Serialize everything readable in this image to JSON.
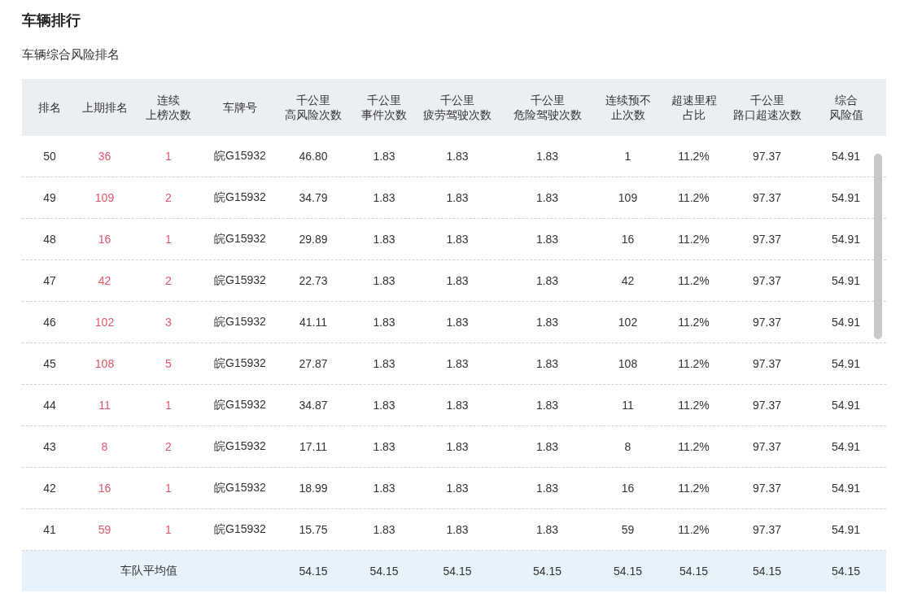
{
  "page": {
    "title": "车辆排行",
    "subtitle": "车辆综合风险排名"
  },
  "table": {
    "columns": [
      {
        "label_lines": [
          "排名"
        ],
        "kind": "plain"
      },
      {
        "label_lines": [
          "上期排名"
        ],
        "kind": "alert"
      },
      {
        "label_lines": [
          "连续",
          "上榜次数"
        ],
        "kind": "alert"
      },
      {
        "label_lines": [
          "车牌号"
        ],
        "kind": "plain"
      },
      {
        "label_lines": [
          "千公里",
          "高风险次数"
        ],
        "kind": "plain"
      },
      {
        "label_lines": [
          "千公里",
          "事件次数"
        ],
        "kind": "plain"
      },
      {
        "label_lines": [
          "千公里",
          "疲劳驾驶次数"
        ],
        "kind": "plain"
      },
      {
        "label_lines": [
          "千公里",
          "危险驾驶次数"
        ],
        "kind": "plain"
      },
      {
        "label_lines": [
          "连续预不",
          "止次数"
        ],
        "kind": "plain"
      },
      {
        "label_lines": [
          "超速里程",
          "占比"
        ],
        "kind": "plain"
      },
      {
        "label_lines": [
          "千公里",
          "路口超速次数"
        ],
        "kind": "plain"
      },
      {
        "label_lines": [
          "综合",
          "风险值"
        ],
        "kind": "plain"
      }
    ],
    "rows": [
      [
        "50",
        "36",
        "1",
        "皖G15932",
        "46.80",
        "1.83",
        "1.83",
        "1.83",
        "1",
        "11.2%",
        "97.37",
        "54.91"
      ],
      [
        "49",
        "109",
        "2",
        "皖G15932",
        "34.79",
        "1.83",
        "1.83",
        "1.83",
        "109",
        "11.2%",
        "97.37",
        "54.91"
      ],
      [
        "48",
        "16",
        "1",
        "皖G15932",
        "29.89",
        "1.83",
        "1.83",
        "1.83",
        "16",
        "11.2%",
        "97.37",
        "54.91"
      ],
      [
        "47",
        "42",
        "2",
        "皖G15932",
        "22.73",
        "1.83",
        "1.83",
        "1.83",
        "42",
        "11.2%",
        "97.37",
        "54.91"
      ],
      [
        "46",
        "102",
        "3",
        "皖G15932",
        "41.11",
        "1.83",
        "1.83",
        "1.83",
        "102",
        "11.2%",
        "97.37",
        "54.91"
      ],
      [
        "45",
        "108",
        "5",
        "皖G15932",
        "27.87",
        "1.83",
        "1.83",
        "1.83",
        "108",
        "11.2%",
        "97.37",
        "54.91"
      ],
      [
        "44",
        "11",
        "1",
        "皖G15932",
        "34.87",
        "1.83",
        "1.83",
        "1.83",
        "11",
        "11.2%",
        "97.37",
        "54.91"
      ],
      [
        "43",
        "8",
        "2",
        "皖G15932",
        "17.11",
        "1.83",
        "1.83",
        "1.83",
        "8",
        "11.2%",
        "97.37",
        "54.91"
      ],
      [
        "42",
        "16",
        "1",
        "皖G15932",
        "18.99",
        "1.83",
        "1.83",
        "1.83",
        "16",
        "11.2%",
        "97.37",
        "54.91"
      ],
      [
        "41",
        "59",
        "1",
        "皖G15932",
        "15.75",
        "1.83",
        "1.83",
        "1.83",
        "59",
        "11.2%",
        "97.37",
        "54.91"
      ]
    ],
    "footer": {
      "label": "车队平均值",
      "values": [
        "54.15",
        "54.15",
        "54.15",
        "54.15",
        "54.15",
        "54.15",
        "54.15",
        "54.15"
      ]
    }
  }
}
